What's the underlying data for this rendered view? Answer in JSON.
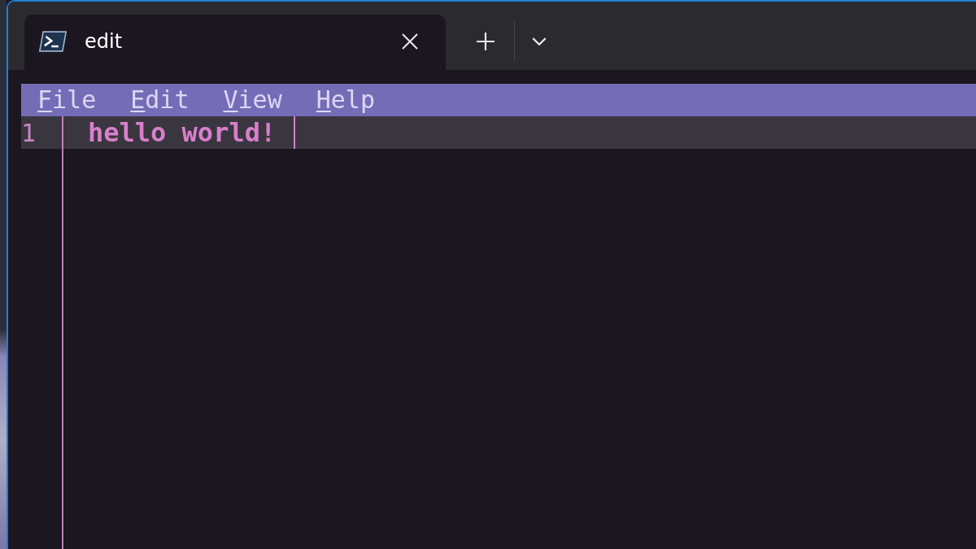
{
  "tab": {
    "title": "edit",
    "selected": true
  },
  "menu": [
    {
      "key": "F",
      "rest": "ile"
    },
    {
      "key": "E",
      "rest": "dit"
    },
    {
      "key": "V",
      "rest": "iew"
    },
    {
      "key": "H",
      "rest": "elp"
    }
  ],
  "editor": {
    "lines": [
      {
        "number": "1",
        "text": "hello world!",
        "current": true
      }
    ]
  }
}
